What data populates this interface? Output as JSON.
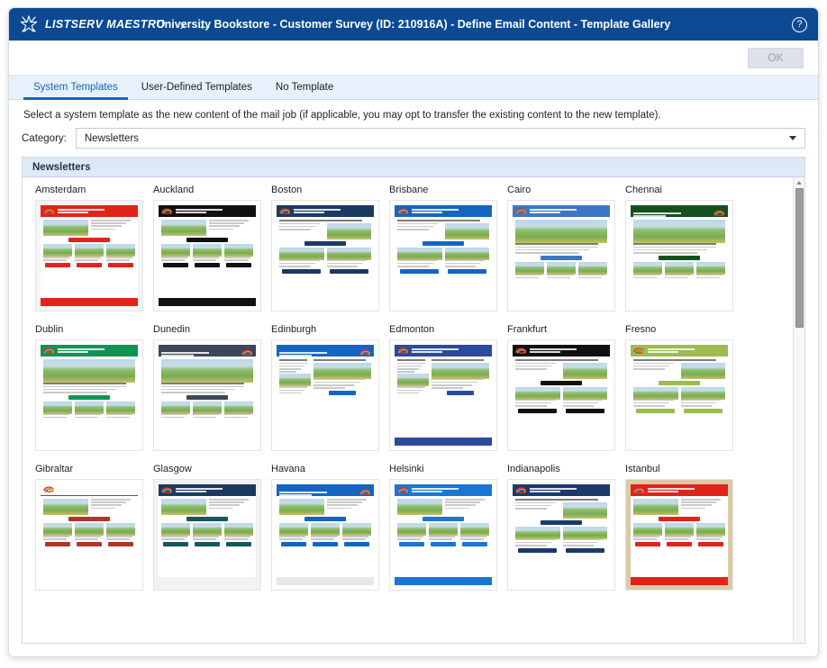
{
  "window": {
    "brand": "LISTSERV MAESTRO",
    "title": "University Bookstore - Customer Survey (ID: 210916A) - Define Email Content - Template Gallery",
    "forward_arrow": "›",
    "back_arrow": "←",
    "help_label": "?",
    "titlebar_color": "#0b4a93"
  },
  "actionbar": {
    "ok_label": "OK",
    "ok_enabled": false
  },
  "tabs": [
    {
      "label": "System Templates",
      "active": true
    },
    {
      "label": "User-Defined Templates",
      "active": false
    },
    {
      "label": "No Template",
      "active": false
    }
  ],
  "instructions": "Select a system template as the new content of the mail job (if applicable, you may opt to transfer the existing content to the new template).",
  "category": {
    "label": "Category:",
    "value": "Newsletters",
    "options": [
      "Newsletters"
    ]
  },
  "gallery": {
    "section_title": "Newsletters",
    "scrollbar": {
      "position": "top",
      "visible": true
    },
    "templates": [
      {
        "name": "Amsterdam",
        "accent": "#e2231a",
        "band_bg": "#e2231a",
        "band_text": "#ffffff",
        "logo_align": "left",
        "layout": "hero-3col",
        "footer": "#e2231a",
        "page_bg": "#f4f4f4"
      },
      {
        "name": "Auckland",
        "accent": "#111111",
        "band_bg": "#111111",
        "band_text": "#ffffff",
        "logo_align": "left",
        "layout": "hero-3col",
        "footer": "#111111",
        "page_bg": "#ffffff"
      },
      {
        "name": "Boston",
        "accent": "#1b3a63",
        "band_bg": "#1b3a63",
        "band_text": "#ffffff",
        "logo_align": "left",
        "layout": "split-2col",
        "footer": "#ffffff",
        "page_bg": "#ffffff"
      },
      {
        "name": "Brisbane",
        "accent": "#1565c0",
        "band_bg": "#1565c0",
        "band_text": "#ffffff",
        "logo_align": "left",
        "layout": "split-2col",
        "footer": "#ffffff",
        "page_bg": "#ffffff"
      },
      {
        "name": "Cairo",
        "accent": "#3f76c4",
        "band_bg": "#3f76c4",
        "band_text": "#ffffff",
        "logo_align": "left",
        "layout": "bighero",
        "footer": "#ffffff",
        "page_bg": "#ffffff"
      },
      {
        "name": "Chennai",
        "accent": "#14501e",
        "band_bg": "#14501e",
        "band_text": "#ffffff",
        "logo_align": "right",
        "layout": "bighero",
        "footer": "#ffffff",
        "page_bg": "#ffffff"
      },
      {
        "name": "Dublin",
        "accent": "#119354",
        "band_bg": "#119354",
        "band_text": "#ffffff",
        "logo_align": "left",
        "layout": "bighero",
        "footer": "#ffffff",
        "page_bg": "#ffffff"
      },
      {
        "name": "Dunedin",
        "accent": "#3d4758",
        "band_bg": "#3d4758",
        "band_text": "#ffffff",
        "logo_align": "right",
        "layout": "bighero",
        "footer": "#ffffff",
        "page_bg": "#ffffff"
      },
      {
        "name": "Edinburgh",
        "accent": "#1565c0",
        "band_bg": "#1565c0",
        "band_text": "#ffffff",
        "logo_align": "right",
        "layout": "sidebar",
        "footer": "#ffffff",
        "page_bg": "#ffffff"
      },
      {
        "name": "Edmonton",
        "accent": "#2b4a9b",
        "band_bg": "#2b4a9b",
        "band_text": "#ffffff",
        "logo_align": "left",
        "layout": "sidebar",
        "footer": "#2b4a9b",
        "page_bg": "#ffffff"
      },
      {
        "name": "Frankfurt",
        "accent": "#111111",
        "band_bg": "#111111",
        "band_text": "#ffffff",
        "logo_align": "left",
        "layout": "split-2col",
        "footer": "#ffffff",
        "page_bg": "#ffffff"
      },
      {
        "name": "Fresno",
        "accent": "#9dbb4f",
        "band_bg": "#9dbb4f",
        "band_text": "#ffffff",
        "logo_align": "left",
        "layout": "split-2col",
        "footer": "#ffffff",
        "page_bg": "#ffffff"
      },
      {
        "name": "Gibraltar",
        "accent": "#b0352c",
        "band_bg": "#ffffff",
        "band_text": "#555555",
        "logo_align": "left",
        "layout": "hero-3col",
        "footer": "#ffffff",
        "page_bg": "#ffffff"
      },
      {
        "name": "Glasgow",
        "accent": "#17585e",
        "band_bg": "#1b3a63",
        "band_text": "#ffffff",
        "logo_align": "left",
        "layout": "hero-3col",
        "footer": "#f2f2f2",
        "page_bg": "#f2f2f2"
      },
      {
        "name": "Havana",
        "accent": "#1565c0",
        "band_bg": "#1565c0",
        "band_text": "#ffffff",
        "logo_align": "right",
        "layout": "hero-3col",
        "footer": "#e8e8e8",
        "page_bg": "#ffffff"
      },
      {
        "name": "Helsinki",
        "accent": "#1976d2",
        "band_bg": "#1976d2",
        "band_text": "#ffffff",
        "logo_align": "left",
        "layout": "hero-3col",
        "footer": "#1976d2",
        "page_bg": "#ffffff"
      },
      {
        "name": "Indianapolis",
        "accent": "#1b3a6b",
        "band_bg": "#1b3a6b",
        "band_text": "#ffffff",
        "logo_align": "left",
        "layout": "split-2col",
        "footer": "#ffffff",
        "page_bg": "#ffffff"
      },
      {
        "name": "Istanbul",
        "accent": "#e2231a",
        "band_bg": "#e2231a",
        "band_text": "#ffffff",
        "logo_align": "left",
        "layout": "hero-3col",
        "footer": "#e2231a",
        "page_bg": "#d9cba8"
      }
    ]
  }
}
